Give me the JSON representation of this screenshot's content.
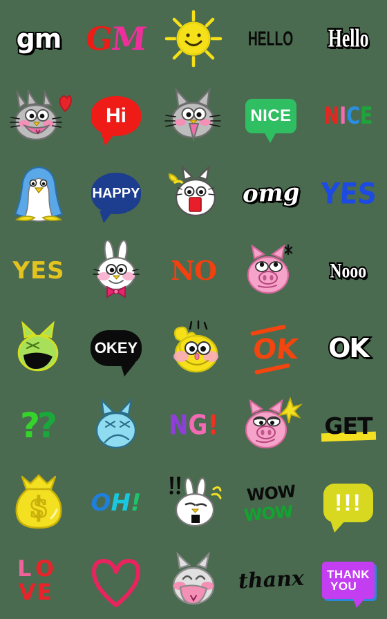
{
  "page": {
    "title": "Emoji Sticker Set",
    "background_color": "#4a6b4f",
    "grid": {
      "columns": 5,
      "rows": 8,
      "cell_size": 112
    }
  },
  "palette": {
    "background": "#4a6b4f",
    "red": "#ee1b16",
    "pink": "#ee2f9b",
    "yellow": "#f2e021",
    "green": "#2fbf62",
    "navy": "#1d3d8f",
    "blue": "#1c4ae2",
    "orange": "#f2450f",
    "purple": "#c23ef0",
    "black": "#0b0b0b",
    "white": "#ffffff"
  },
  "stickers": [
    {
      "id": "gm-white",
      "row": 1,
      "col": 1,
      "type": "text",
      "label": "gm",
      "colors": [
        "#ffffff",
        "#000000"
      ]
    },
    {
      "id": "gm-pink-red",
      "row": 1,
      "col": 2,
      "type": "text",
      "label": "GM",
      "parts": [
        "G",
        "M"
      ],
      "colors": [
        "#ee1b16",
        "#ee2f9b"
      ]
    },
    {
      "id": "sun-smiling",
      "row": 1,
      "col": 3,
      "type": "character",
      "label": "smiling sun",
      "colors": [
        "#f5e019"
      ]
    },
    {
      "id": "hello-black",
      "row": 1,
      "col": 4,
      "type": "text",
      "label": "HELLO",
      "colors": [
        "#0a0a0a"
      ]
    },
    {
      "id": "hello-white",
      "row": 1,
      "col": 5,
      "type": "text",
      "label": "Hello",
      "colors": [
        "#ffffff",
        "#000000"
      ]
    },
    {
      "id": "gray-cat-heart",
      "row": 2,
      "col": 1,
      "type": "character",
      "label": "gray cat with heart",
      "colors": [
        "#b5b5b5",
        "#f48fb6",
        "#e8242b"
      ]
    },
    {
      "id": "hi-bubble",
      "row": 2,
      "col": 2,
      "type": "bubble",
      "label": "Hi",
      "colors": [
        "#ee1b16",
        "#ffffff"
      ]
    },
    {
      "id": "gray-cat-open",
      "row": 2,
      "col": 3,
      "type": "character",
      "label": "gray cat open mouth",
      "colors": [
        "#b5b5b5",
        "#f06ea8"
      ]
    },
    {
      "id": "nice-green",
      "row": 2,
      "col": 4,
      "type": "bubble",
      "label": "NICE",
      "colors": [
        "#2fbf62",
        "#ffffff"
      ]
    },
    {
      "id": "nice-multicolor",
      "row": 2,
      "col": 5,
      "type": "text",
      "label": "NICE",
      "parts": [
        "N",
        "I",
        "C",
        "E"
      ],
      "colors": [
        "#e8251f",
        "#f56ab0",
        "#2b8fe0",
        "#1fa33c"
      ]
    },
    {
      "id": "penguin",
      "row": 3,
      "col": 1,
      "type": "character",
      "label": "blue penguin",
      "colors": [
        "#5aa8e8",
        "#ffffff",
        "#f2e021"
      ]
    },
    {
      "id": "happy-bubble",
      "row": 3,
      "col": 2,
      "type": "bubble",
      "label": "HAPPY",
      "colors": [
        "#1d3d8f",
        "#ffffff"
      ]
    },
    {
      "id": "shocked-cat",
      "row": 3,
      "col": 3,
      "type": "character",
      "label": "shocked white cat",
      "colors": [
        "#ffffff",
        "#e81f2b",
        "#f2e021"
      ]
    },
    {
      "id": "omg-white",
      "row": 3,
      "col": 4,
      "type": "text",
      "label": "omg",
      "colors": [
        "#ffffff",
        "#000000"
      ]
    },
    {
      "id": "yes-blue",
      "row": 3,
      "col": 5,
      "type": "text",
      "label": "YES",
      "colors": [
        "#1c4ae2"
      ]
    },
    {
      "id": "yes-gold",
      "row": 4,
      "col": 1,
      "type": "text",
      "label": "YES",
      "colors": [
        "#e3c320"
      ]
    },
    {
      "id": "rabbit-bowtie",
      "row": 4,
      "col": 2,
      "type": "character",
      "label": "white rabbit with bow tie",
      "colors": [
        "#ffffff",
        "#f78fc0",
        "#e8246b"
      ]
    },
    {
      "id": "no-orange",
      "row": 4,
      "col": 3,
      "type": "text",
      "label": "NO",
      "colors": [
        "#f2400f"
      ]
    },
    {
      "id": "pig-bored",
      "row": 4,
      "col": 4,
      "type": "character",
      "label": "pink pig bored",
      "colors": [
        "#f5a3c8",
        "#0b0b0b"
      ]
    },
    {
      "id": "nooo-white",
      "row": 4,
      "col": 5,
      "type": "text",
      "label": "Nooo",
      "colors": [
        "#ffffff",
        "#000000"
      ]
    },
    {
      "id": "green-cat-yell",
      "row": 5,
      "col": 1,
      "type": "character",
      "label": "green cat yelling",
      "colors": [
        "#a8e05a",
        "#0b0b0b"
      ]
    },
    {
      "id": "okey-bubble",
      "row": 5,
      "col": 2,
      "type": "bubble",
      "label": "OKEY",
      "colors": [
        "#0b0b0b",
        "#ffffff"
      ]
    },
    {
      "id": "yellow-char",
      "row": 5,
      "col": 3,
      "type": "character",
      "label": "yellow character smiling",
      "colors": [
        "#f5e019",
        "#f78fc0"
      ]
    },
    {
      "id": "ok-slashes",
      "row": 5,
      "col": 4,
      "type": "text",
      "label": "OK",
      "colors": [
        "#f2450f"
      ]
    },
    {
      "id": "ok-white",
      "row": 5,
      "col": 5,
      "type": "text",
      "label": "OK",
      "colors": [
        "#ffffff",
        "#000000"
      ]
    },
    {
      "id": "question-marks",
      "row": 6,
      "col": 1,
      "type": "text",
      "label": "??",
      "parts": [
        "?",
        "?"
      ],
      "colors": [
        "#35d42b",
        "#1aa83c"
      ]
    },
    {
      "id": "blue-cat-sad",
      "row": 6,
      "col": 2,
      "type": "character",
      "label": "blue cat sad",
      "colors": [
        "#8fdcf0",
        "#2b6e8a"
      ]
    },
    {
      "id": "ng-text",
      "row": 6,
      "col": 3,
      "type": "text",
      "label": "NG!",
      "parts": [
        "N",
        "G",
        "!"
      ],
      "colors": [
        "#8e3fd8",
        "#f26ab4",
        "#f03020"
      ]
    },
    {
      "id": "pig-smug",
      "row": 6,
      "col": 4,
      "type": "character",
      "label": "pink pig smug with sparkle",
      "colors": [
        "#f5a3c8",
        "#f2e021"
      ]
    },
    {
      "id": "get-highlight",
      "row": 6,
      "col": 5,
      "type": "text",
      "label": "GET",
      "colors": [
        "#0b0b0b",
        "#f2e021"
      ]
    },
    {
      "id": "money-bag",
      "row": 7,
      "col": 1,
      "type": "character",
      "label": "yellow money bag",
      "symbol": "$",
      "colors": [
        "#f2e021"
      ]
    },
    {
      "id": "oh-text",
      "row": 7,
      "col": 2,
      "type": "text",
      "label": "OH!",
      "parts": [
        "O",
        "H",
        "!"
      ],
      "colors": [
        "#1e7fdd",
        "#18c8e0",
        "#1fc36e"
      ]
    },
    {
      "id": "rabbit-excl",
      "row": 7,
      "col": 3,
      "type": "character",
      "label": "white rabbit with exclamations",
      "colors": [
        "#ffffff",
        "#0b0b0b",
        "#f2e021"
      ]
    },
    {
      "id": "wow-double",
      "row": 7,
      "col": 4,
      "type": "text",
      "label": "WOW",
      "parts": [
        "WOW",
        "WOW"
      ],
      "colors": [
        "#0b0b0b",
        "#13a330"
      ]
    },
    {
      "id": "excl-bubble",
      "row": 7,
      "col": 5,
      "type": "bubble",
      "label": "!!!",
      "colors": [
        "#d8d820",
        "#ffffff"
      ]
    },
    {
      "id": "love-text",
      "row": 8,
      "col": 1,
      "type": "text",
      "label": "LOVE",
      "parts": [
        "L",
        "O",
        "V",
        "E"
      ],
      "colors": [
        "#f0629c",
        "#e8242b"
      ]
    },
    {
      "id": "heart-outline",
      "row": 8,
      "col": 2,
      "type": "character",
      "label": "red heart outline",
      "colors": [
        "#e8245e"
      ]
    },
    {
      "id": "gray-cat-laugh",
      "row": 8,
      "col": 3,
      "type": "character",
      "label": "gray cat laughing",
      "colors": [
        "#d8d8d8",
        "#f48fb6"
      ]
    },
    {
      "id": "thanx-script",
      "row": 8,
      "col": 4,
      "type": "text",
      "label": "thanx",
      "colors": [
        "#0b0b0b"
      ]
    },
    {
      "id": "thank-you",
      "row": 8,
      "col": 5,
      "type": "bubble",
      "label": "THANK YOU",
      "lines": [
        "THANK",
        "YOU"
      ],
      "colors": [
        "#c23ef0",
        "#ffffff",
        "#2e86d8"
      ]
    }
  ]
}
